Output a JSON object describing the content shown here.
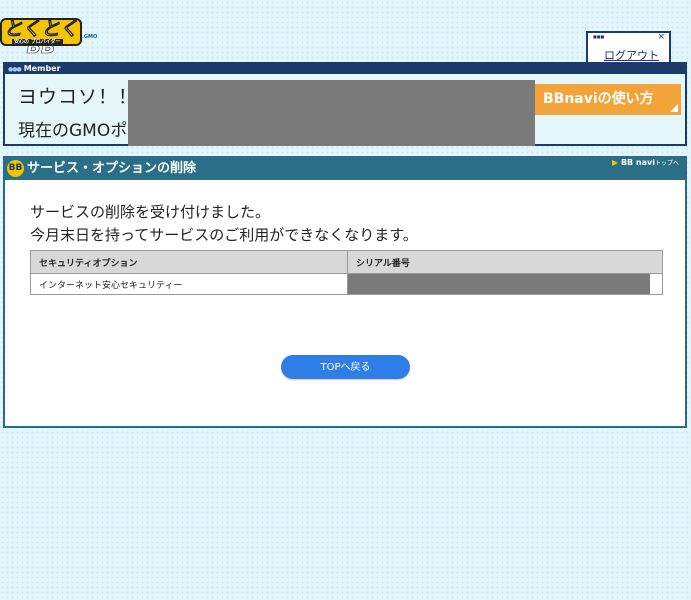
{
  "header": {
    "logo_text": "とくとくBB",
    "logo_subtext": "安心の プロバイダー",
    "logo_tail": ".GMO",
    "logout_label": "ログアウト",
    "close_glyph": "×"
  },
  "member": {
    "bar_label": "Member",
    "greeting": "ヨウコソ！！",
    "status_text": "現在のGMOポ",
    "bbnavi_button": "BBnaviの使い方"
  },
  "panel": {
    "title": "サービス・オプションの削除",
    "top_link": "BB navi",
    "top_link_suffix": "トップへ",
    "message_line1": "サービスの削除を受け付けました。",
    "message_line2": "今月末日を持ってサービスのご利用ができなくなります。",
    "table": {
      "headers": [
        "セキュリティオプション",
        "シリアル番号"
      ],
      "rows": [
        {
          "option": "インターネット安心セキュリティー"
        }
      ]
    },
    "top_button": "TOPへ戻る"
  },
  "colors": {
    "header_bar": "#1b3b6b",
    "panel_header": "#2a6f86",
    "bbnavi_orange": "#f2a33a",
    "top_button_blue": "#2f7ee8"
  }
}
